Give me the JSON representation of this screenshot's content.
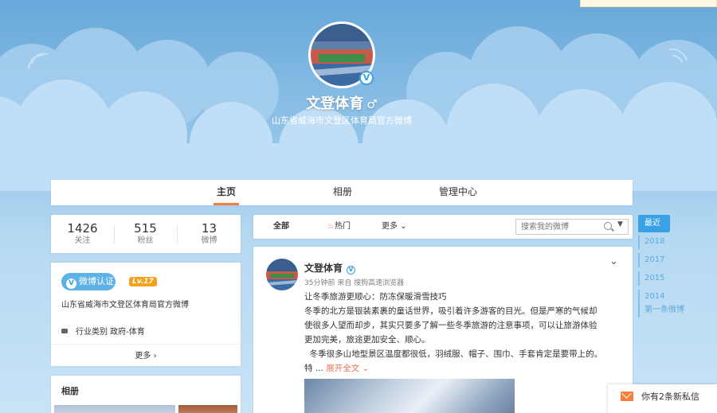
{
  "profile": {
    "name": "文登体育",
    "gender_symbol": "♂",
    "description": "山东省威海市文登区体育局官方微博",
    "verified_symbol": "V"
  },
  "nav": {
    "tabs": [
      {
        "label": "主页",
        "active": true
      },
      {
        "label": "相册",
        "active": false
      },
      {
        "label": "管理中心",
        "active": false
      }
    ]
  },
  "stats": [
    {
      "value": "1426",
      "label": "关注"
    },
    {
      "value": "515",
      "label": "粉丝"
    },
    {
      "value": "13",
      "label": "微博"
    }
  ],
  "info": {
    "verify_label": "微博认证",
    "verify_symbol": "V",
    "level_label": "Lv.17",
    "description": "山东省威海市文登区体育局官方微博",
    "industry": "行业类别  政府-体育",
    "more_label": "更多 ›"
  },
  "album": {
    "title": "相册"
  },
  "feed_tabs": {
    "all": "全部",
    "hot": "热门",
    "hot_icon": "fire-icon",
    "more": "更多 ⌄",
    "search_placeholder": "搜索我的微博",
    "search_caret": "▼"
  },
  "post": {
    "author": "文登体育",
    "verified_symbol": "V",
    "meta": "35分钟前 来自 搜狗高速浏览器",
    "chevron": "⌄",
    "lines": [
      "让冬季旅游更顺心：防冻保暖滑雪技巧",
      "冬季的北方是银装素裹的童话世界，吸引着许多游客的目光。但是严寒的气候却",
      "使很多人望而却步，其实只要多了解一些冬季旅游的注意事项，可以让旅游体验",
      "更加完美，旅途更加安全、顺心。",
      "  冬季很多山地型景区温度都很低，羽绒服、帽子、围巾、手套肯定是要带上的。"
    ],
    "last_line_prefix": "特 ... ",
    "expand_label": "展开全文 ⌄"
  },
  "timeline": {
    "active": "最近",
    "years": [
      "2018",
      "2017",
      "2015",
      "2014"
    ],
    "first": "第一条微博"
  },
  "message_popup": {
    "text": "你有2条新私信"
  },
  "colors": {
    "accent": "#fa7d3c",
    "verify_blue": "#3aa2e4",
    "sky": "#8fc2e8"
  }
}
